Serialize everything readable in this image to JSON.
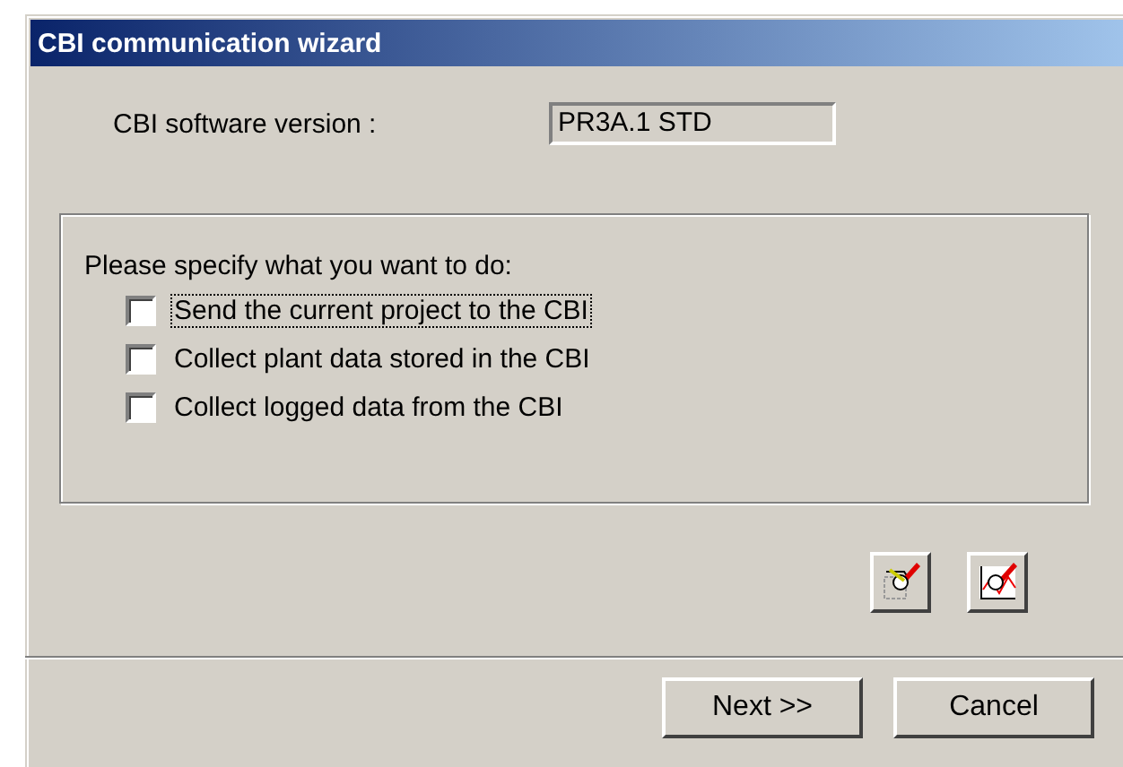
{
  "window": {
    "title": "CBI communication wizard"
  },
  "version": {
    "label": "CBI software version :",
    "value": "PR3A.1 STD"
  },
  "group": {
    "prompt": "Please specify what you want to do:",
    "options": [
      {
        "label": "Send the current project to the CBI",
        "checked": false,
        "focused": true
      },
      {
        "label": "Collect plant data stored in the CBI",
        "checked": false,
        "focused": false
      },
      {
        "label": "Collect logged data from the CBI",
        "checked": false,
        "focused": false
      }
    ]
  },
  "tool_buttons": [
    {
      "kind": "unit"
    },
    {
      "kind": "chart"
    }
  ],
  "buttons": [
    "Next >>",
    "Cancel"
  ]
}
